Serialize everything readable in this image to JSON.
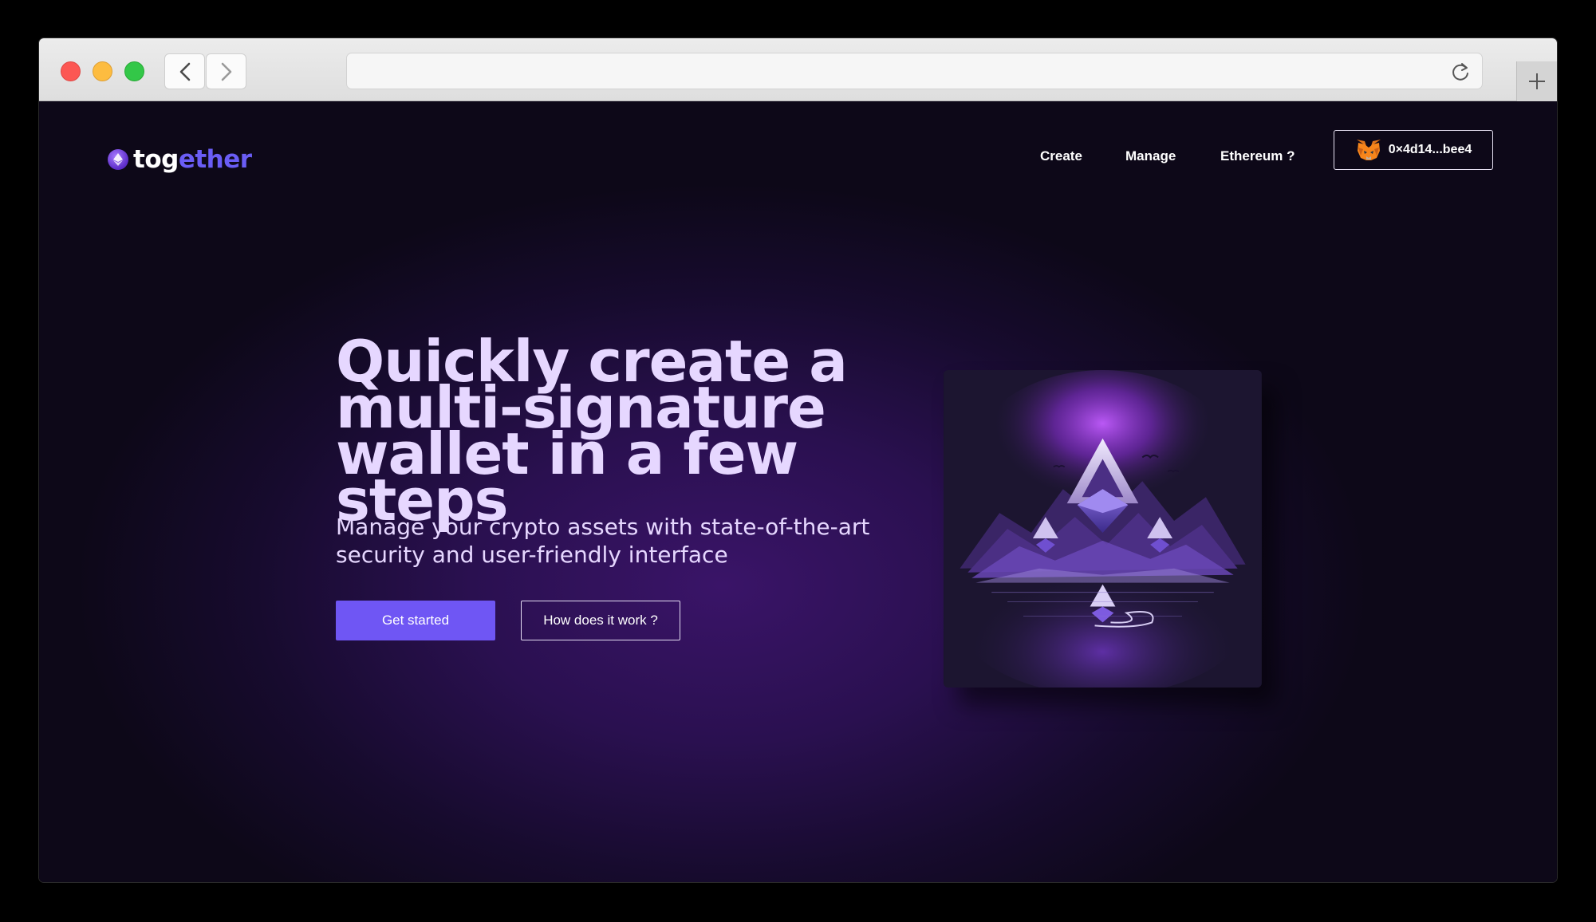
{
  "browser": {
    "url": "",
    "icons": {
      "back": "chevron-left-icon",
      "forward": "chevron-right-icon",
      "reload": "reload-icon",
      "new_tab": "plus-icon"
    }
  },
  "header": {
    "logo": {
      "part1": "tog",
      "part2": "ether",
      "icon": "ethereum-logo-icon"
    },
    "nav": [
      {
        "label": "Create"
      },
      {
        "label": "Manage"
      },
      {
        "label": "Ethereum ?"
      }
    ],
    "wallet": {
      "address": "0×4d14...bee4",
      "icon": "metamask-fox-icon"
    }
  },
  "hero": {
    "title_lines": [
      "Quickly create a",
      "multi-signature",
      "wallet in a few steps"
    ],
    "subtitle_lines": [
      "Manage your crypto assets with state-of-the-art",
      "security and user-friendly interface"
    ],
    "primary_cta": "Get started",
    "secondary_cta": "How does it work ?",
    "image": "ethereum-mountain-illustration"
  },
  "colors": {
    "accent": "#6f56f4",
    "logo_accent": "#6a5df5",
    "hero_text": "#e6d7ff",
    "background": "#0d0818"
  }
}
